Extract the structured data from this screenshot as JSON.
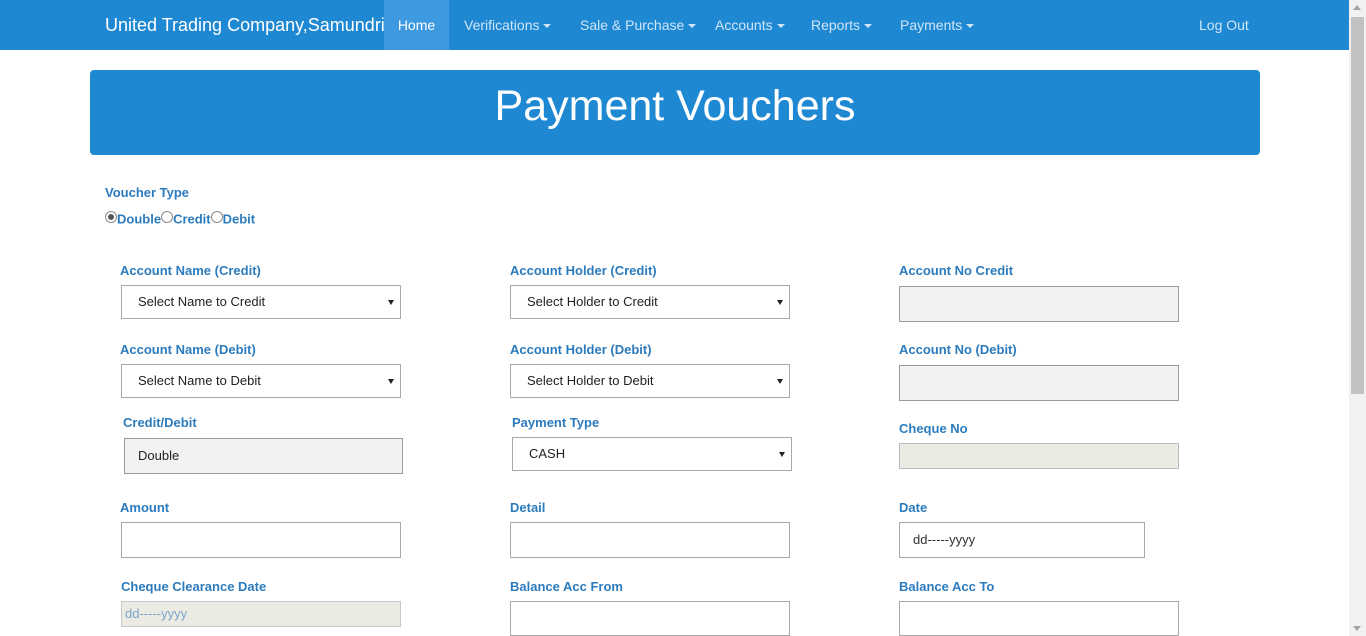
{
  "navbar": {
    "brand": "United Trading Company,Samundri",
    "items": [
      {
        "label": "Home",
        "active": true
      },
      {
        "label": "Verifications",
        "dropdown": true
      },
      {
        "label": "Sale & Purchase",
        "dropdown": true
      },
      {
        "label": "Accounts",
        "dropdown": true
      },
      {
        "label": "Reports",
        "dropdown": true
      },
      {
        "label": "Payments",
        "dropdown": true
      }
    ],
    "logout": "Log Out"
  },
  "banner": {
    "title": "Payment Vouchers"
  },
  "voucher_type": {
    "label": "Voucher Type",
    "options": [
      "Double",
      "Credit",
      "Debit"
    ],
    "selected": "Double"
  },
  "form": {
    "account_name_credit": {
      "label": "Account Name (Credit)",
      "value": "Select Name to Credit"
    },
    "account_holder_credit": {
      "label": "Account Holder (Credit)",
      "value": "Select Holder to Credit"
    },
    "account_no_credit": {
      "label": "Account No Credit",
      "value": ""
    },
    "account_name_debit": {
      "label": "Account Name (Debit)",
      "value": "Select Name to Debit"
    },
    "account_holder_debit": {
      "label": "Account Holder (Debit)",
      "value": "Select Holder to Debit"
    },
    "account_no_debit": {
      "label": "Account No (Debit)",
      "value": ""
    },
    "credit_debit": {
      "label": "Credit/Debit",
      "value": "Double"
    },
    "payment_type": {
      "label": "Payment Type",
      "value": "CASH"
    },
    "cheque_no": {
      "label": "Cheque No",
      "value": ""
    },
    "amount": {
      "label": "Amount",
      "value": ""
    },
    "detail": {
      "label": "Detail",
      "value": ""
    },
    "date": {
      "label": "Date",
      "placeholder": "dd-----yyyy"
    },
    "cheque_clearance_date": {
      "label": "Cheque Clearance Date",
      "placeholder": "dd-----yyyy"
    },
    "balance_acc_from": {
      "label": "Balance Acc From",
      "value": ""
    },
    "balance_acc_to": {
      "label": "Balance Acc To",
      "value": ""
    }
  }
}
